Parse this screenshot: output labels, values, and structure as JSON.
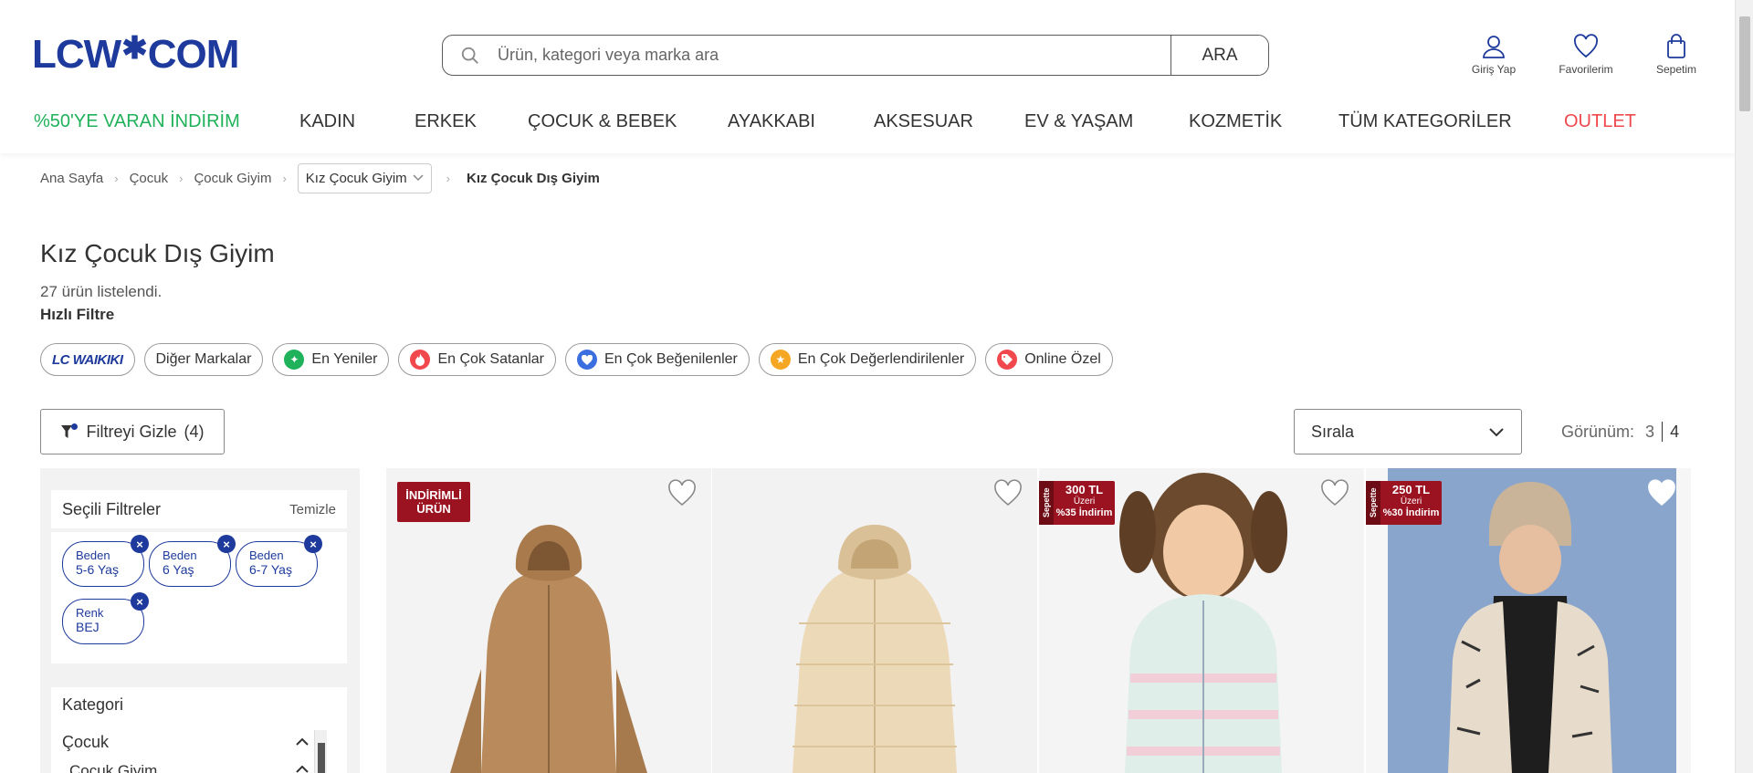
{
  "header": {
    "logo": "LCW*COM",
    "search_placeholder": "Ürün, kategori veya marka ara",
    "search_button": "ARA",
    "actions": [
      {
        "label": "Giriş Yap",
        "icon": "user-icon"
      },
      {
        "label": "Favorilerim",
        "icon": "heart-icon"
      },
      {
        "label": "Sepetim",
        "icon": "shopping-bag-icon"
      }
    ]
  },
  "nav": [
    {
      "label": "%50'YE VARAN İNDİRİM",
      "color": "#1fb25a"
    },
    {
      "label": "KADIN"
    },
    {
      "label": "ERKEK"
    },
    {
      "label": "ÇOCUK & BEBEK"
    },
    {
      "label": "AYAKKABI"
    },
    {
      "label": "AKSESUAR"
    },
    {
      "label": "EV & YAŞAM"
    },
    {
      "label": "KOZMETİK"
    },
    {
      "label": "TÜM KATEGORİLER"
    },
    {
      "label": "OUTLET",
      "color": "#f0484d"
    }
  ],
  "breadcrumb": {
    "items": [
      "Ana Sayfa",
      "Çocuk",
      "Çocuk Giyim"
    ],
    "dropdown": "Kız Çocuk Giyim",
    "current": "Kız Çocuk Dış Giyim"
  },
  "page": {
    "title": "Kız Çocuk Dış Giyim",
    "result_count": "27 ürün listelendi.",
    "quick_filter_label": "Hızlı Filtre"
  },
  "chips": [
    {
      "label": "LC WAIKIKI",
      "icon": "lcw-brand-logo"
    },
    {
      "label": "Diğer Markalar"
    },
    {
      "label": "En Yeniler",
      "icon": "new-icon",
      "color": "#1fb25a"
    },
    {
      "label": "En Çok Satanlar",
      "icon": "fire-icon",
      "color": "#f0484d"
    },
    {
      "label": "En Çok Beğenilenler",
      "icon": "heart-icon",
      "color": "#3b6fe0"
    },
    {
      "label": "En Çok Değerlendirilenler",
      "icon": "star-icon",
      "color": "#f5a623"
    },
    {
      "label": "Online Özel",
      "icon": "tag-icon",
      "color": "#f0484d"
    }
  ],
  "toolbar": {
    "filter_toggle": "Filtreyi Gizle",
    "filter_count": "(4)",
    "sort_label": "Sırala",
    "view_label": "Görünüm:",
    "view_options": [
      "3",
      "4"
    ],
    "view_active": "4"
  },
  "sidebar": {
    "selected_title": "Seçili Filtreler",
    "clear": "Temizle",
    "selected_filters": [
      {
        "key": "Beden",
        "value": "5-6 Yaş"
      },
      {
        "key": "Beden",
        "value": "6 Yaş"
      },
      {
        "key": "Beden",
        "value": "6-7 Yaş"
      },
      {
        "key": "Renk",
        "value": "BEJ"
      }
    ],
    "category_title": "Kategori",
    "category_items": [
      "Çocuk",
      "Çocuk Giyim"
    ]
  },
  "products": [
    {
      "badge": "İNDİRİMLİ ÜRÜN",
      "badge_type": "discount",
      "image": "brown-fur-jacket"
    },
    {
      "badge": "",
      "image": "beige-puffer-coat"
    },
    {
      "badge_side": "Sepette",
      "badge_amount": "300 TL",
      "badge_over": "Üzeri",
      "badge_discount": "%35 İndirim",
      "badge_type": "basket",
      "image": "girl-quilted-jacket"
    },
    {
      "badge_side": "Sepette",
      "badge_amount": "250 TL",
      "badge_over": "Üzeri",
      "badge_discount": "%30 İndirim",
      "badge_type": "basket",
      "image": "girl-printed-puffer"
    }
  ],
  "colors": {
    "brand_blue": "#1d3a9c",
    "sale_green": "#1fb25a",
    "outlet_red": "#f0484d",
    "badge_red": "#9b1220"
  }
}
